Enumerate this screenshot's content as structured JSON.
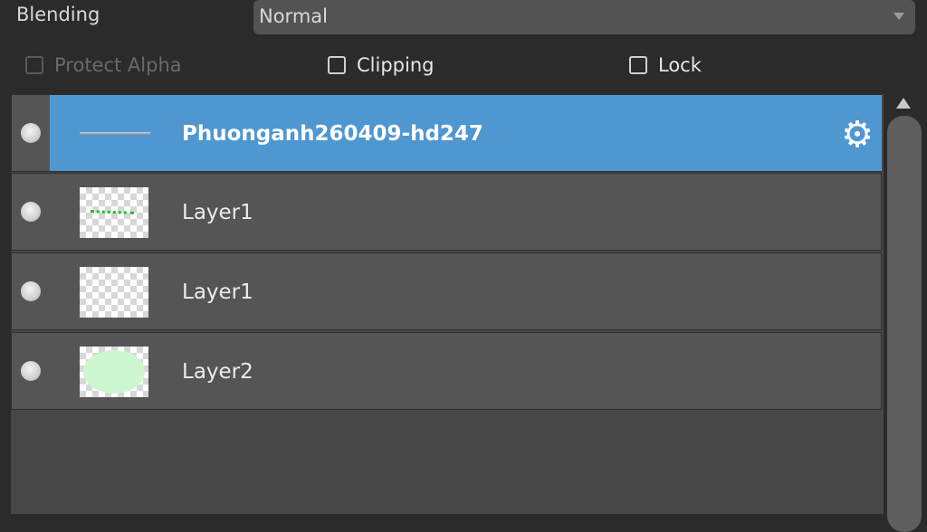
{
  "blending": {
    "label": "Blending",
    "value": "Normal"
  },
  "options": {
    "protect_alpha": {
      "label": "Protect Alpha",
      "checked": false,
      "enabled": false
    },
    "clipping": {
      "label": "Clipping",
      "checked": false,
      "enabled": true
    },
    "lock": {
      "label": "Lock",
      "checked": false,
      "enabled": true
    }
  },
  "layers": [
    {
      "name": "Phuonganh260409-hd247",
      "selected": true,
      "visible": true,
      "thumbnail": "line-icon",
      "settings_icon": "gear-icon"
    },
    {
      "name": "Layer1",
      "selected": false,
      "visible": true,
      "thumbnail": "green-text-thumbnail"
    },
    {
      "name": "Layer1",
      "selected": false,
      "visible": true,
      "thumbnail": "empty-transparent-thumbnail"
    },
    {
      "name": "Layer2",
      "selected": false,
      "visible": true,
      "thumbnail": "green-blob-thumbnail"
    }
  ],
  "colors": {
    "selection": "#4f97d1",
    "panel": "#555555",
    "background": "#2b2b2b"
  }
}
